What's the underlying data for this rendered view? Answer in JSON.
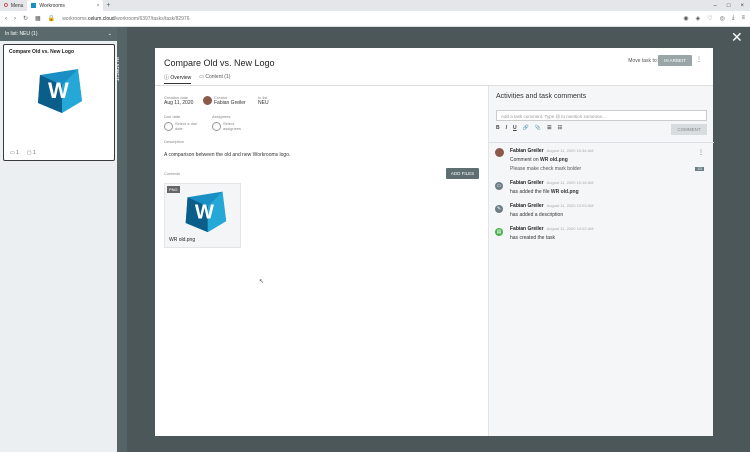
{
  "browser": {
    "tabs": [
      {
        "label": "Menu"
      },
      {
        "label": "Workrooms"
      }
    ],
    "add_tab": "+",
    "url_prefix": "workrooms.",
    "url_domain": "celum.cloud",
    "url_path": "/workroom/6397/tasks/task/82976"
  },
  "left_panel": {
    "header": "In list: NEU (1)",
    "task_card": {
      "title": "Compare Old vs. New Logo",
      "files_count": "1",
      "comments_count": "1"
    }
  },
  "vertical_strip_label": "IN ARBEIT",
  "modal": {
    "title": "Compare Old vs. New Logo",
    "tabs": [
      "Overview",
      "Content (1)"
    ],
    "move_task_label": "Move task to:",
    "move_task_button": "IN ARBEIT",
    "creation_date_label": "Creation date",
    "creation_date": "Aug 11, 2020",
    "creator_label": "Creator",
    "creator": "Fabian Greiler",
    "in_list_label": "In list",
    "in_list": "NEU",
    "due_date_label": "Due date",
    "due_date_placeholder": "Select a due date",
    "assignees_label": "Assignees",
    "assignees_placeholder": "Select assignees",
    "description_label": "Description",
    "description": "A comparison between the old and new Workrooms logo.",
    "contents_label": "Contents",
    "add_files_button": "ADD FILES",
    "file": {
      "badge": "PNG",
      "name": "WR old.png"
    }
  },
  "activity": {
    "title": "Activities and task comments",
    "comment_placeholder": "Add a task comment. Type @ to mention someone...",
    "toolbar": [
      "B",
      "I",
      "U",
      "🔗",
      "📎",
      "☰",
      "☷"
    ],
    "comment_button": "COMMENT",
    "items": [
      {
        "user": "Fabian Greiler",
        "time": "August 11, 2020 10:34 AM",
        "text": "Comment on",
        "file": "WR old.png",
        "text2": "Please make check mark bolder",
        "badge": "1/3"
      },
      {
        "user": "Fabian Greiler",
        "time": "August 11, 2020 10:18 AM",
        "text": "has added the file",
        "file": "WR old.png"
      },
      {
        "user": "Fabian Greiler",
        "time": "August 11, 2020 10:03 AM",
        "text": "has added a description"
      },
      {
        "user": "Fabian Greiler",
        "time": "August 11, 2020 10:02 AM",
        "text": "has created the task"
      }
    ]
  },
  "colors": {
    "accent": "#5f6f71",
    "logo_blue": "#1a8fc4",
    "logo_dark": "#0b5e8a"
  }
}
